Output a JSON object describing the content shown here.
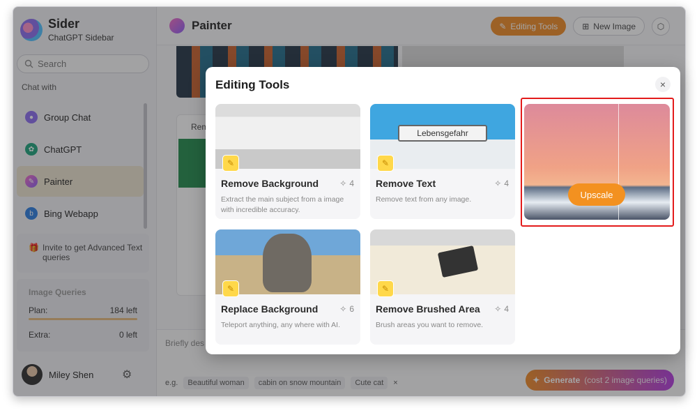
{
  "sidebar": {
    "app_name": "Sider",
    "app_subtitle": "ChatGPT Sidebar",
    "search_placeholder": "Search",
    "chat_with_label": "Chat with",
    "items": [
      {
        "label": "Group Chat",
        "icon": "group-chat-icon"
      },
      {
        "label": "ChatGPT",
        "icon": "chatgpt-icon"
      },
      {
        "label": "Painter",
        "icon": "painter-icon",
        "active": true
      },
      {
        "label": "Bing Webapp",
        "icon": "bing-icon"
      }
    ],
    "invite_text": "Invite to get Advanced Text queries",
    "image_queries": {
      "title": "Image Queries",
      "plan_label": "Plan:",
      "plan_value": "184 left",
      "extra_label": "Extra:",
      "extra_value": "0 left"
    },
    "user_name": "Miley Shen"
  },
  "header": {
    "title": "Painter",
    "editing_tools_label": "Editing Tools",
    "new_image_label": "New Image"
  },
  "gallery": {
    "card_label": "Rem"
  },
  "composer": {
    "placeholder": "Briefly des",
    "eg_label": "e.g.",
    "suggestions": [
      "Beautiful woman",
      "cabin on snow mountain",
      "Cute cat"
    ],
    "generate_label": "Generate",
    "generate_cost": "(cost 2 image queries)"
  },
  "modal": {
    "title": "Editing Tools",
    "close_glyph": "×",
    "tools": [
      {
        "name": "Remove Background",
        "count": "4",
        "desc": "Extract the main subject from a image with incredible accuracy."
      },
      {
        "name": "Remove Text",
        "count": "4",
        "desc": "Remove text from any image."
      },
      {
        "name": "Replace Background",
        "count": "6",
        "desc": "Teleport anything, any where with AI."
      },
      {
        "name": "Remove Brushed Area",
        "count": "4",
        "desc": "Brush areas you want to remove."
      }
    ],
    "upscale_label": "Upscale",
    "image_text_sign": "Lebensgefahr"
  },
  "colors": {
    "accent_orange": "#ef8a23",
    "highlight_red": "#e31b1b",
    "active_item_bg": "#ece3cf"
  }
}
